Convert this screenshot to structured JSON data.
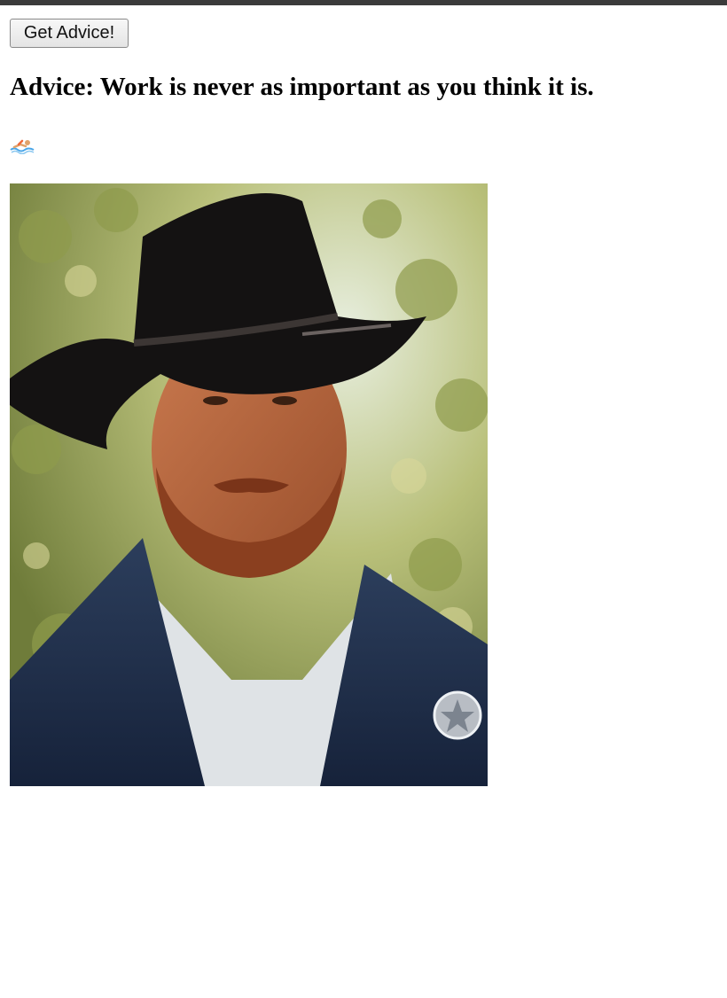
{
  "button": {
    "label": "Get Advice!"
  },
  "advice": {
    "prefix": "Advice:",
    "text": "Work is never as important as you think it is."
  },
  "emoji_icon": "swimmer-icon",
  "photo": {
    "subject": "portrait-photo"
  },
  "colors": {
    "topbar": "#3b3b3b",
    "background": "#ffffff"
  }
}
